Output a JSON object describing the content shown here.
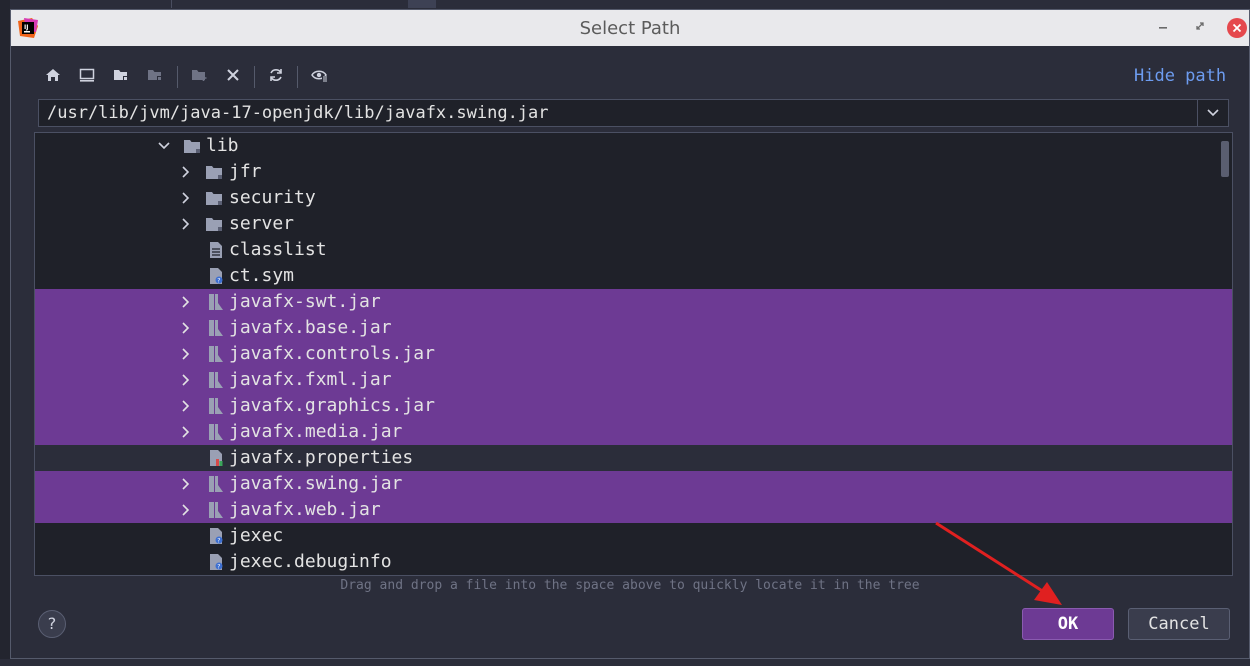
{
  "window": {
    "title": "Select Path"
  },
  "toolbar": {
    "buttons": [
      "home-icon",
      "desktop-icon",
      "project-folder-icon",
      "module-folder-icon",
      "new-folder-icon",
      "delete-icon",
      "refresh-icon",
      "show-hidden-icon"
    ],
    "hide_path": "Hide path"
  },
  "path": {
    "value": "/usr/lib/jvm/java-17-openjdk/lib/javafx.swing.jar"
  },
  "tree": {
    "rows": [
      {
        "label": "lib",
        "kind": "folder",
        "expanded": true
      },
      {
        "label": "jfr",
        "kind": "folder"
      },
      {
        "label": "security",
        "kind": "folder"
      },
      {
        "label": "server",
        "kind": "folder"
      },
      {
        "label": "classlist",
        "kind": "text-file"
      },
      {
        "label": "ct.sym",
        "kind": "file"
      },
      {
        "label": "javafx-swt.jar",
        "kind": "jar",
        "selected": true
      },
      {
        "label": "javafx.base.jar",
        "kind": "jar",
        "selected": true
      },
      {
        "label": "javafx.controls.jar",
        "kind": "jar",
        "selected": true
      },
      {
        "label": "javafx.fxml.jar",
        "kind": "jar",
        "selected": true
      },
      {
        "label": "javafx.graphics.jar",
        "kind": "jar",
        "selected": true
      },
      {
        "label": "javafx.media.jar",
        "kind": "jar",
        "selected": true
      },
      {
        "label": "javafx.properties",
        "kind": "properties"
      },
      {
        "label": "javafx.swing.jar",
        "kind": "jar",
        "selected": true
      },
      {
        "label": "javafx.web.jar",
        "kind": "jar",
        "selected": true
      },
      {
        "label": "jexec",
        "kind": "file"
      },
      {
        "label": "jexec.debuginfo",
        "kind": "file"
      }
    ]
  },
  "hint": "Drag and drop a file into the space above to quickly locate it in the tree",
  "buttons": {
    "help": "?",
    "ok": "OK",
    "cancel": "Cancel"
  },
  "colors": {
    "selection": "#6d3a94",
    "link": "#6d9cf0",
    "annotation_arrow": "#e02020"
  }
}
